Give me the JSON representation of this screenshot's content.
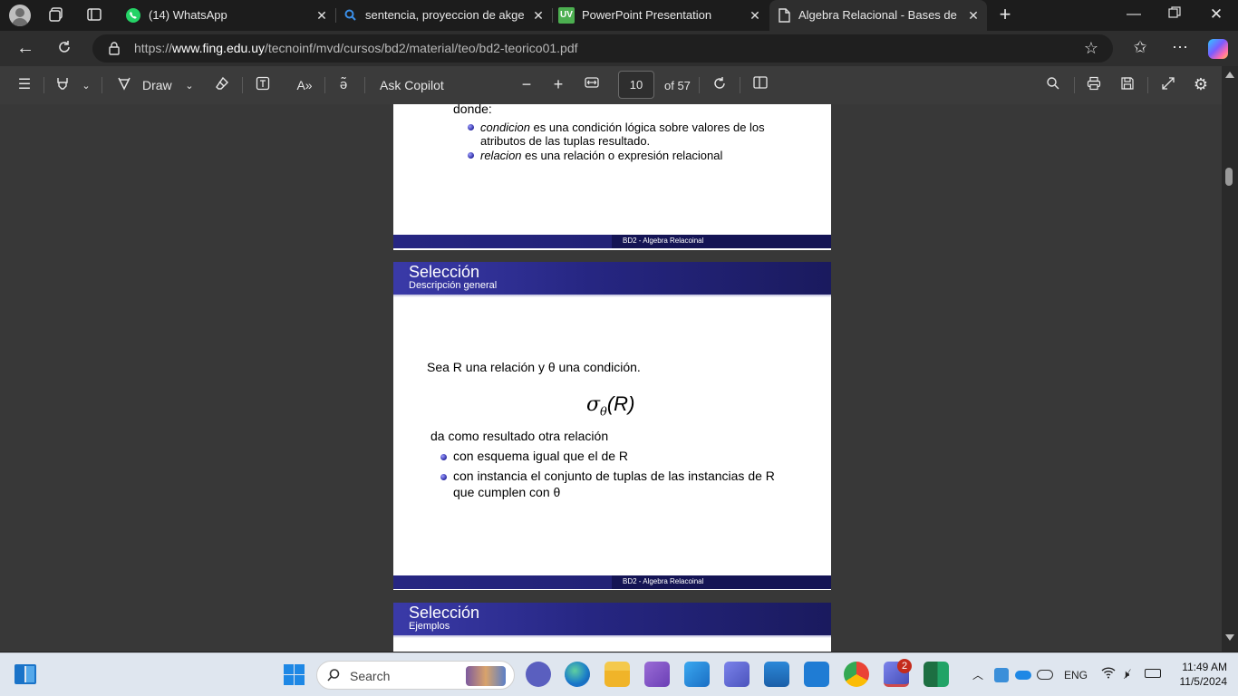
{
  "tabs": [
    {
      "label": "(14) WhatsApp",
      "icon": "whatsapp-icon"
    },
    {
      "label": "sentencia, proyeccion de akgebra",
      "icon": "search-icon"
    },
    {
      "label": "PowerPoint Presentation",
      "icon": "uv-icon"
    },
    {
      "label": "Algebra Relacional - Bases de Dat",
      "icon": "pdf-page-icon"
    }
  ],
  "address": {
    "prefix": "https://",
    "domain": "www.fing.edu.uy",
    "path": "/tecnoinf/mvd/cursos/bd2/material/teo/bd2-teorico01.pdf"
  },
  "pdf_toolbar": {
    "draw_label": "Draw",
    "ask_label": "Ask Copilot",
    "page_value": "10",
    "of_label": "of 57"
  },
  "slide_top": {
    "intro": "donde:",
    "bullets": [
      {
        "em": "condicion",
        "rest": " es una condición lógica sobre valores de los",
        "line2": "atributos de las tuplas resultado."
      },
      {
        "em": "relacion",
        "rest": " es una relación o expresión relacional",
        "line2": ""
      }
    ],
    "footer": "BD2 - Algebra Relacoinal"
  },
  "slide_main": {
    "title": "Selección",
    "subtitle": "Descripción general",
    "line1": "Sea R una relación y θ una condición.",
    "formula_sigma": "σ",
    "formula_sub": "θ",
    "formula_arg": "(R)",
    "result": "da como resultado otra relación",
    "bullets": [
      "con esquema igual que el de R",
      "con instancia el conjunto de tuplas de las instancias de R"
    ],
    "bullet2_line2": "que cumplen con θ",
    "footer": "BD2 - Algebra Relacoinal"
  },
  "slide_next": {
    "title": "Selección",
    "subtitle": "Ejemplos"
  },
  "taskbar": {
    "search_placeholder": "Search",
    "lang": "ENG",
    "time": "11:49 AM",
    "date": "11/5/2024",
    "teams_badge": "2"
  },
  "colors": {
    "slide_blue": "#262682",
    "tab_active": "#2e2e2e",
    "toolbar": "#3b3b3b",
    "viewer_bg": "#383838"
  }
}
